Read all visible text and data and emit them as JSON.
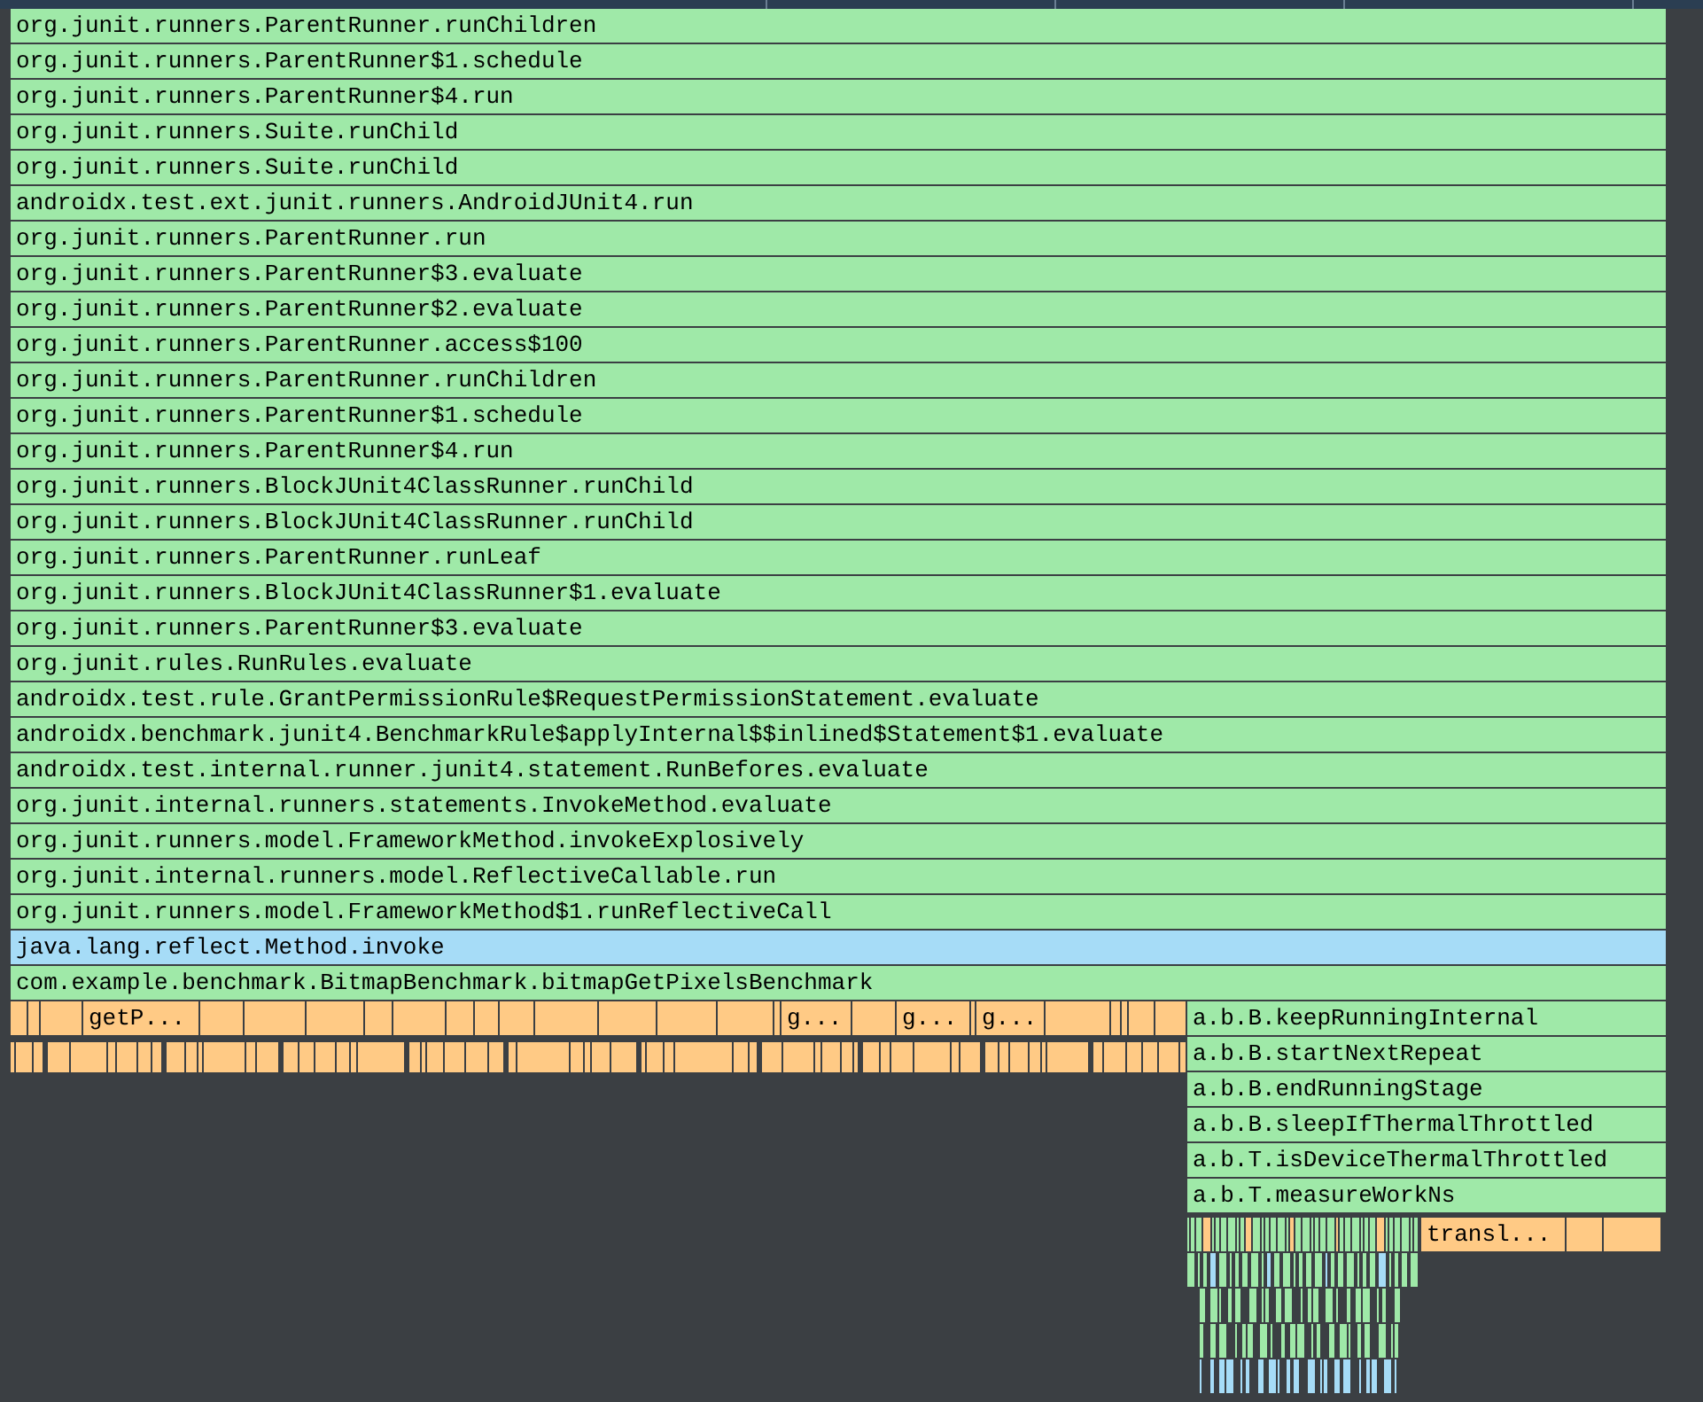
{
  "stack": [
    {
      "label": "org.junit.runners.ParentRunner.runChildren",
      "color": "#9fe9a8"
    },
    {
      "label": "org.junit.runners.ParentRunner$1.schedule",
      "color": "#9fe9a8"
    },
    {
      "label": "org.junit.runners.ParentRunner$4.run",
      "color": "#9fe9a8"
    },
    {
      "label": "org.junit.runners.Suite.runChild",
      "color": "#9fe9a8"
    },
    {
      "label": "org.junit.runners.Suite.runChild",
      "color": "#9fe9a8"
    },
    {
      "label": "androidx.test.ext.junit.runners.AndroidJUnit4.run",
      "color": "#9fe9a8"
    },
    {
      "label": "org.junit.runners.ParentRunner.run",
      "color": "#9fe9a8"
    },
    {
      "label": "org.junit.runners.ParentRunner$3.evaluate",
      "color": "#9fe9a8"
    },
    {
      "label": "org.junit.runners.ParentRunner$2.evaluate",
      "color": "#9fe9a8"
    },
    {
      "label": "org.junit.runners.ParentRunner.access$100",
      "color": "#9fe9a8"
    },
    {
      "label": "org.junit.runners.ParentRunner.runChildren",
      "color": "#9fe9a8"
    },
    {
      "label": "org.junit.runners.ParentRunner$1.schedule",
      "color": "#9fe9a8"
    },
    {
      "label": "org.junit.runners.ParentRunner$4.run",
      "color": "#9fe9a8"
    },
    {
      "label": "org.junit.runners.BlockJUnit4ClassRunner.runChild",
      "color": "#9fe9a8"
    },
    {
      "label": "org.junit.runners.BlockJUnit4ClassRunner.runChild",
      "color": "#9fe9a8"
    },
    {
      "label": "org.junit.runners.ParentRunner.runLeaf",
      "color": "#9fe9a8"
    },
    {
      "label": "org.junit.runners.BlockJUnit4ClassRunner$1.evaluate",
      "color": "#9fe9a8"
    },
    {
      "label": "org.junit.runners.ParentRunner$3.evaluate",
      "color": "#9fe9a8"
    },
    {
      "label": "org.junit.rules.RunRules.evaluate",
      "color": "#9fe9a8"
    },
    {
      "label": "androidx.test.rule.GrantPermissionRule$RequestPermissionStatement.evaluate",
      "color": "#9fe9a8"
    },
    {
      "label": "androidx.benchmark.junit4.BenchmarkRule$applyInternal$$inlined$Statement$1.evaluate",
      "color": "#9fe9a8"
    },
    {
      "label": "androidx.test.internal.runner.junit4.statement.RunBefores.evaluate",
      "color": "#9fe9a8"
    },
    {
      "label": "org.junit.internal.runners.statements.InvokeMethod.evaluate",
      "color": "#9fe9a8"
    },
    {
      "label": "org.junit.runners.model.FrameworkMethod.invokeExplosively",
      "color": "#9fe9a8"
    },
    {
      "label": "org.junit.internal.runners.model.ReflectiveCallable.run",
      "color": "#9fe9a8"
    },
    {
      "label": "org.junit.runners.model.FrameworkMethod$1.runReflectiveCall",
      "color": "#9fe9a8"
    },
    {
      "label": "java.lang.reflect.Method.invoke",
      "color": "#a6dcf7"
    },
    {
      "label": "com.example.benchmark.BitmapBenchmark.bitmapGetPixelsBenchmark",
      "color": "#9fe9a8"
    }
  ],
  "left_labels": [
    {
      "label": "getP...",
      "color": "#ffca85"
    },
    {
      "label": "g...",
      "color": "#ffca85"
    },
    {
      "label": "g...",
      "color": "#ffca85"
    },
    {
      "label": "g...",
      "color": "#ffca85"
    }
  ],
  "right_stack": [
    {
      "label": "a.b.B.keepRunningInternal",
      "color": "#9fe9a8"
    },
    {
      "label": "a.b.B.startNextRepeat",
      "color": "#9fe9a8"
    },
    {
      "label": "a.b.B.endRunningStage",
      "color": "#9fe9a8"
    },
    {
      "label": "a.b.B.sleepIfThermalThrottled",
      "color": "#9fe9a8"
    },
    {
      "label": "a.b.T.isDeviceThermalThrottled",
      "color": "#9fe9a8"
    },
    {
      "label": "a.b.T.measureWorkNs",
      "color": "#9fe9a8"
    }
  ],
  "tail": {
    "label": "transl...",
    "color": "#ffca85"
  }
}
